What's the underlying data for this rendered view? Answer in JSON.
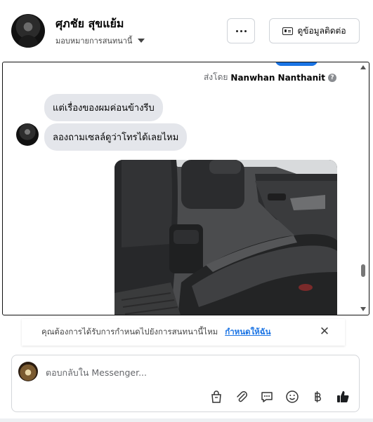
{
  "header": {
    "contact_name": "ศุภชัย สุขแย้ม",
    "assign_label": "มอบหมายการสนทนานี้",
    "more_label": "More options",
    "contact_info_label": "ดูข้อมูลติดต่อ"
  },
  "thread": {
    "sent_by_prefix": "ส่งโดย",
    "sent_by_name": "Nanwhan Nanthanit",
    "messages": [
      {
        "text": "แต่เรื่องของผมค่อนข้างรีบ"
      },
      {
        "text": "ลองถามเซลล์ดูว่าโทรได้เลยไหม"
      }
    ]
  },
  "reminder": {
    "question": "คุณต้องการได้รับการกำหนดไปยังการสนทนานี้ไหม",
    "action": "กำหนดให้ฉัน"
  },
  "composer": {
    "placeholder": "ตอบกลับใน Messenger...",
    "tools": [
      "shopping-bag-icon",
      "paperclip-icon",
      "chat-bubble-icon",
      "emoji-icon",
      "baht-icon",
      "thumbs-up-icon"
    ]
  },
  "colors": {
    "accent": "#1b74e4",
    "bubble": "#e4e6eb",
    "like": "#0866ff"
  }
}
